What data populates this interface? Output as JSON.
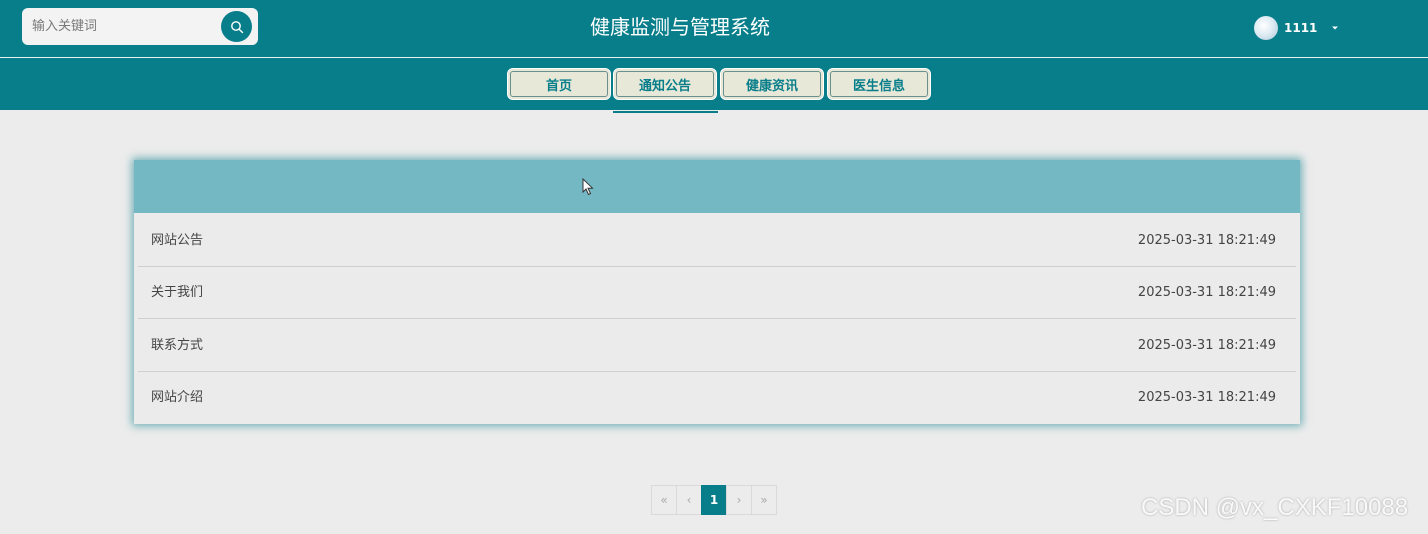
{
  "header": {
    "title": "健康监测与管理系统",
    "search": {
      "placeholder": "输入关键词",
      "value": ""
    },
    "user": {
      "name": "1111"
    }
  },
  "nav": {
    "tabs": [
      {
        "label": "首页"
      },
      {
        "label": "通知公告",
        "active": true
      },
      {
        "label": "健康资讯"
      },
      {
        "label": "医生信息"
      }
    ]
  },
  "notices": {
    "rows": [
      {
        "title": "网站公告",
        "date": "2025-03-31 18:21:49"
      },
      {
        "title": "关于我们",
        "date": "2025-03-31 18:21:49"
      },
      {
        "title": "联系方式",
        "date": "2025-03-31 18:21:49"
      },
      {
        "title": "网站介绍",
        "date": "2025-03-31 18:21:49"
      }
    ]
  },
  "pagination": {
    "first": "«",
    "prev": "‹",
    "current": "1",
    "next": "›",
    "last": "»"
  },
  "watermark": "CSDN @vx_CXKF10088",
  "colors": {
    "primary": "#087e8b",
    "card_header": "#74b8c4",
    "background": "#ececec",
    "tab_bg": "#e8e8d8"
  },
  "icons": {
    "search": "search-icon",
    "caret": "caret-down-icon",
    "cursor": "mouse-pointer-icon"
  }
}
